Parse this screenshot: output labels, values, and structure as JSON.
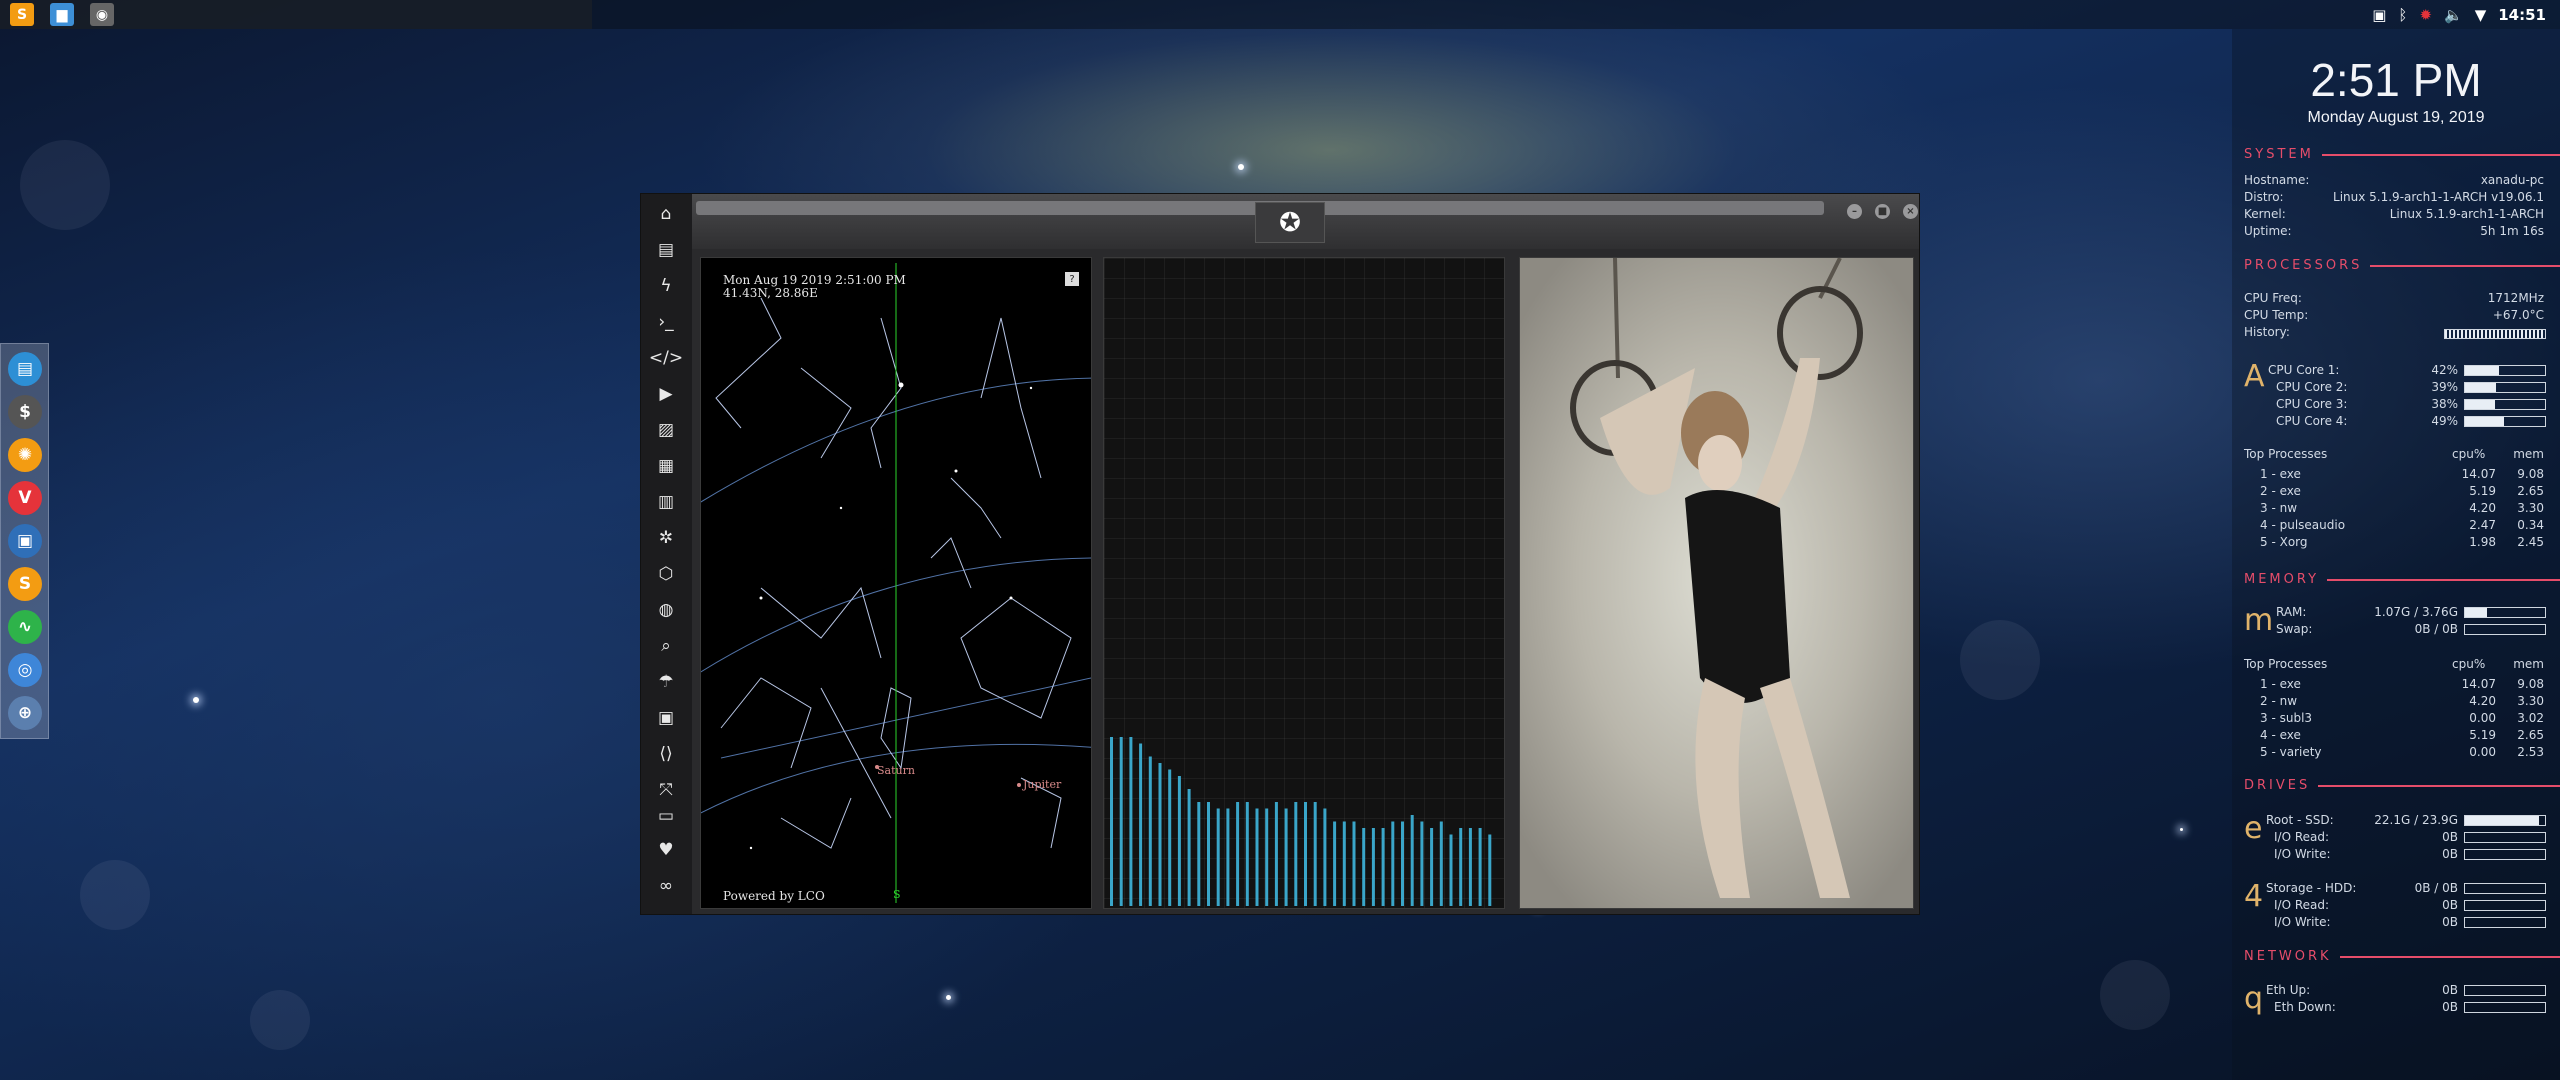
{
  "tray": {
    "time": "14:51",
    "icons": [
      "image-icon",
      "bluetooth-icon",
      "settings-gear-icon",
      "volume-icon",
      "wifi-icon"
    ]
  },
  "top_launchers": [
    {
      "name": "sublime-launcher",
      "glyph": "S",
      "color": "#f39c12"
    },
    {
      "name": "files-launcher",
      "glyph": "▆",
      "color": "#3d8fd6"
    },
    {
      "name": "app-launcher",
      "glyph": "◉",
      "color": "#666666"
    }
  ],
  "dock": [
    {
      "name": "files-app",
      "glyph": "▤",
      "color": "#2d8fd5"
    },
    {
      "name": "terminal-app",
      "glyph": "$",
      "color": "#555555"
    },
    {
      "name": "ubuntu-app",
      "glyph": "✺",
      "color": "#f39c12"
    },
    {
      "name": "vivaldi-app",
      "glyph": "V",
      "color": "#e5333a"
    },
    {
      "name": "screen-app",
      "glyph": "▣",
      "color": "#2f6fb8"
    },
    {
      "name": "sublime-app",
      "glyph": "S",
      "color": "#f39c12"
    },
    {
      "name": "monitor-app",
      "glyph": "∿",
      "color": "#2eb34a"
    },
    {
      "name": "chromium-app",
      "glyph": "◎",
      "color": "#3e86d8"
    },
    {
      "name": "globe-app",
      "glyph": "⊕",
      "color": "#5b7fae"
    }
  ],
  "sky": {
    "datetime": "Mon Aug 19 2019 2:51:00 PM",
    "coords": "41.43N, 28.86E",
    "help": "?",
    "planet1": "Saturn",
    "planet2": "Jupiter",
    "south": "S",
    "credit": "Powered by LCO"
  },
  "conky": {
    "clock": "2:51 PM",
    "date": "Monday August 19, 2019",
    "system_title": "SYSTEM",
    "system": [
      {
        "k": "Hostname:",
        "v": "xanadu-pc"
      },
      {
        "k": "Distro:",
        "v": "Linux 5.1.9-arch1-1-ARCH v19.06.1"
      },
      {
        "k": "Kernel:",
        "v": "Linux 5.1.9-arch1-1-ARCH"
      },
      {
        "k": "Uptime:",
        "v": "5h 1m 16s"
      }
    ],
    "proc_title": "PROCESSORS",
    "cpu_freq_k": "CPU Freq:",
    "cpu_freq_v": "1712MHz",
    "cpu_temp_k": "CPU Temp:",
    "cpu_temp_v": "+67.0°C",
    "history_k": "History:",
    "cpu_letter": "A",
    "cores": [
      {
        "k": "CPU Core 1:",
        "v": "42%",
        "pct": 42
      },
      {
        "k": "CPU Core 2:",
        "v": "39%",
        "pct": 39
      },
      {
        "k": "CPU Core 3:",
        "v": "38%",
        "pct": 38
      },
      {
        "k": "CPU Core 4:",
        "v": "49%",
        "pct": 49
      }
    ],
    "top_cpu": {
      "title": "Top Processes",
      "col1": "cpu%",
      "col2": "mem",
      "rows": [
        {
          "n": "1  -  exe",
          "c": "14.07",
          "m": "9.08"
        },
        {
          "n": "2  -  exe",
          "c": "5.19",
          "m": "2.65"
        },
        {
          "n": "3  -  nw",
          "c": "4.20",
          "m": "3.30"
        },
        {
          "n": "4  -  pulseaudio",
          "c": "2.47",
          "m": "0.34"
        },
        {
          "n": "5  -  Xorg",
          "c": "1.98",
          "m": "2.45"
        }
      ]
    },
    "mem_title": "MEMORY",
    "mem_letter": "m",
    "ram_k": "RAM:",
    "ram_v": "1.07G / 3.76G",
    "ram_pct": 28,
    "swap_k": "Swap:",
    "swap_v": "0B / 0B",
    "top_mem": {
      "title": "Top Processes",
      "col1": "cpu%",
      "col2": "mem",
      "rows": [
        {
          "n": "1  -  exe",
          "c": "14.07",
          "m": "9.08"
        },
        {
          "n": "2  -  nw",
          "c": "4.20",
          "m": "3.30"
        },
        {
          "n": "3  -  subl3",
          "c": "0.00",
          "m": "3.02"
        },
        {
          "n": "4  -  exe",
          "c": "5.19",
          "m": "2.65"
        },
        {
          "n": "5  -  variety",
          "c": "0.00",
          "m": "2.53"
        }
      ]
    },
    "drives_title": "DRIVES",
    "root_letter": "e",
    "root_k": "Root  -  SSD:",
    "root_v": "22.1G / 23.9G",
    "root_pct": 92,
    "root_read_k": "I/O Read:",
    "root_read_v": "0B",
    "root_write_k": "I/O Write:",
    "root_write_v": "0B",
    "stor_letter": "4",
    "stor_k": "Storage  -  HDD:",
    "stor_v": "0B / 0B",
    "stor_read_k": "I/O Read:",
    "stor_read_v": "0B",
    "stor_write_k": "I/O Write:",
    "stor_write_v": "0B",
    "net_title": "NETWORK",
    "net_letter": "q",
    "up_k": "Eth Up:",
    "up_v": "0B",
    "down_k": "Eth Down:",
    "down_v": "0B"
  },
  "audio_levels": [
    0.26,
    0.26,
    0.26,
    0.25,
    0.23,
    0.22,
    0.21,
    0.2,
    0.18,
    0.16,
    0.16,
    0.15,
    0.15,
    0.16,
    0.16,
    0.15,
    0.15,
    0.16,
    0.15,
    0.16,
    0.16,
    0.16,
    0.15,
    0.13,
    0.13,
    0.13,
    0.12,
    0.12,
    0.12,
    0.13,
    0.13,
    0.14,
    0.13,
    0.12,
    0.13,
    0.11,
    0.12,
    0.12,
    0.12,
    0.11
  ],
  "colors": {
    "accent": "#e64d6a",
    "letters": "#e0b36a",
    "audio": "#3aa6c9"
  }
}
